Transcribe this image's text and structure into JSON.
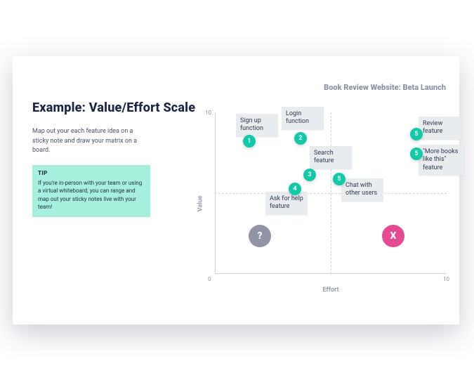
{
  "header": {
    "subheader": "Book Review Website: Beta Launch"
  },
  "left": {
    "title": "Example: Value/Effort Scale",
    "intro": "Map out your each feature idea on a sticky note and draw your matrix on a board.",
    "tip_label": "TIP",
    "tip_body": "If you're in-person with your team or using a virtual whiteboard, you can range and map out your sticky notes live with your team!"
  },
  "chart": {
    "y_axis_label": "Value",
    "x_axis_label": "Effort",
    "y_max": "10",
    "x_max": "10",
    "origin": "0",
    "quadrant_question": "?",
    "quadrant_x": "X"
  },
  "items": {
    "s1": {
      "label": "Sign up function",
      "num": "1"
    },
    "s2": {
      "label": "Login function",
      "num": "2"
    },
    "s3": {
      "label": "Search feature",
      "num": "3"
    },
    "s4": {
      "label": "Ask for help feature",
      "num": "4"
    },
    "s5": {
      "label": "Chat with other users",
      "num": "5"
    },
    "s6": {
      "label": "Review feature",
      "num": "5"
    },
    "s7": {
      "label": "\"More books like this\" feature",
      "num": "5"
    }
  },
  "chart_data": {
    "type": "scatter",
    "title": "Example: Value/Effort Scale",
    "xlabel": "Effort",
    "ylabel": "Value",
    "xlim": [
      0,
      10
    ],
    "ylim": [
      0,
      10
    ],
    "series": [
      {
        "name": "Sign up function",
        "badge": 1,
        "x": 1.4,
        "y": 8.6
      },
      {
        "name": "Login function",
        "badge": 2,
        "x": 3.6,
        "y": 8.4
      },
      {
        "name": "Search feature",
        "badge": 3,
        "x": 3.9,
        "y": 6.6
      },
      {
        "name": "Ask for help feature",
        "badge": 4,
        "x": 3.0,
        "y": 5.0
      },
      {
        "name": "Chat with other users",
        "badge": 5,
        "x": 5.1,
        "y": 5.6
      },
      {
        "name": "Review feature",
        "badge": 5,
        "x": 8.4,
        "y": 8.6
      },
      {
        "name": "\"More books like this\" feature",
        "badge": 5,
        "x": 8.4,
        "y": 7.2
      }
    ],
    "quadrant_markers": [
      {
        "symbol": "?",
        "x": 2.0,
        "y": 2.4,
        "color": "#8f95a5"
      },
      {
        "symbol": "X",
        "x": 7.6,
        "y": 2.4,
        "color": "#e64a93"
      }
    ]
  }
}
